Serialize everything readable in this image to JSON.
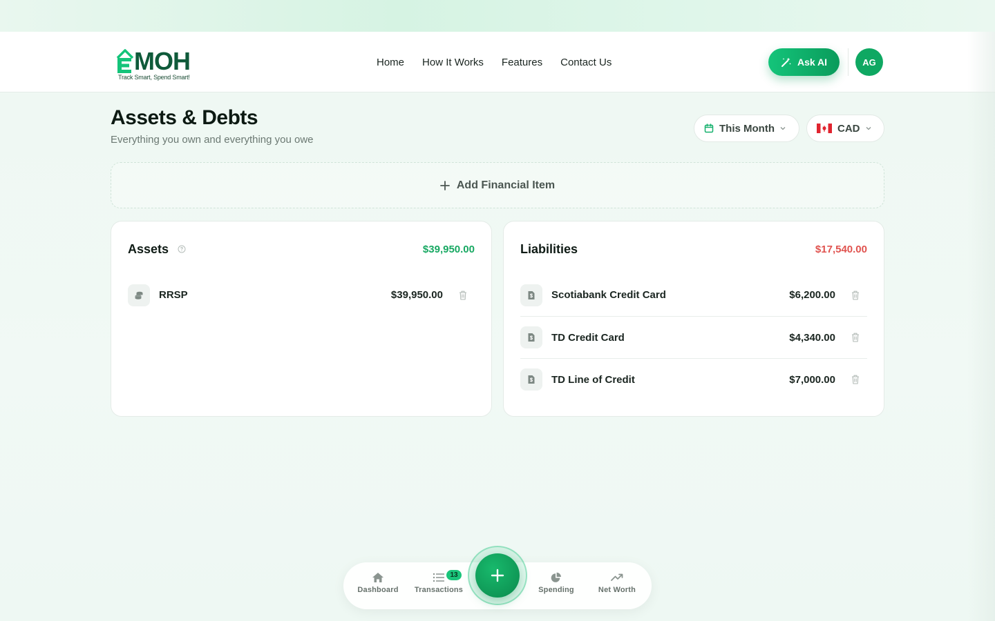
{
  "brand": {
    "name": "MOH",
    "tagline": "Track Smart, Spend Smart!"
  },
  "nav": {
    "links": [
      "Home",
      "How It Works",
      "Features",
      "Contact Us"
    ],
    "ask_ai_label": "Ask AI",
    "avatar_initials": "AG"
  },
  "page": {
    "title": "Assets & Debts",
    "subtitle": "Everything you own and everything you owe"
  },
  "filters": {
    "period": "This Month",
    "currency": "CAD"
  },
  "add_item_label": "Add Financial Item",
  "assets": {
    "title": "Assets",
    "total": "$39,950.00",
    "items": [
      {
        "name": "RRSP",
        "amount": "$39,950.00",
        "icon": "coins-icon"
      }
    ]
  },
  "liabilities": {
    "title": "Liabilities",
    "total": "$17,540.00",
    "items": [
      {
        "name": "Scotiabank Credit Card",
        "amount": "$6,200.00",
        "icon": "bill-icon"
      },
      {
        "name": "TD Credit Card",
        "amount": "$4,340.00",
        "icon": "bill-icon"
      },
      {
        "name": "TD Line of Credit",
        "amount": "$7,000.00",
        "icon": "bill-icon"
      }
    ]
  },
  "bottom_nav": {
    "dashboard": "Dashboard",
    "transactions": "Transactions",
    "transactions_badge": "13",
    "spending": "Spending",
    "net_worth": "Net Worth"
  },
  "colors": {
    "accent": "#14c47a",
    "accent_dark": "#0a9b5b",
    "asset_total": "#17a862",
    "liability_total": "#e0534f"
  }
}
